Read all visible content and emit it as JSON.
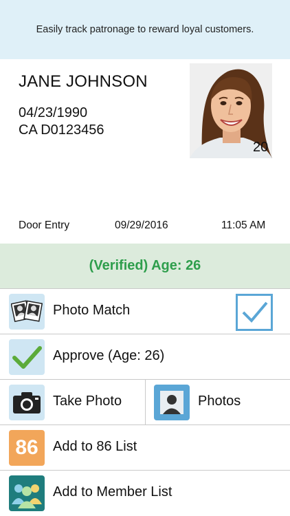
{
  "banner": {
    "text": "Easily track patronage to reward loyal customers."
  },
  "id_card": {
    "name": "JANE JOHNSON",
    "dob": "04/23/1990",
    "license": "CA D0123456",
    "photo_number": "20"
  },
  "scan_info": {
    "location": "Door Entry",
    "date": "09/29/2016",
    "time": "11:05 AM"
  },
  "verification": {
    "text": "(Verified) Age: 26",
    "color": "#2e9e4c"
  },
  "actions": {
    "photo_match": {
      "label": "Photo Match",
      "checked": true,
      "icon": "photo-match-icon"
    },
    "approve": {
      "label": "Approve (Age: 26)",
      "icon": "checkmark-icon"
    },
    "take_photo": {
      "label": "Take Photo",
      "icon": "camera-icon"
    },
    "photos": {
      "label": "Photos",
      "icon": "portrait-icon"
    },
    "add_86": {
      "label": "Add to 86 List",
      "icon_text": "86"
    },
    "add_member": {
      "label": "Add to Member List",
      "icon": "members-icon"
    }
  },
  "colors": {
    "banner_bg": "#dff0f8",
    "verified_bg": "#dcebdc",
    "tile_blue": "#cfe6f3",
    "tile_orange": "#f2a65a",
    "tile_teal": "#1f7d7d",
    "check_green": "#5cab3a",
    "checkbox_blue": "#5aa6d6"
  }
}
